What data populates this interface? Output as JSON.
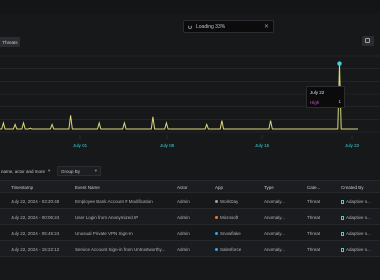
{
  "toast": {
    "text": "Loading 33%"
  },
  "tab": {
    "threats_label": "Threats"
  },
  "chart_data": {
    "type": "line",
    "x_ticks": [
      "July 01",
      "July 08",
      "July 15",
      "July 22"
    ],
    "series": [
      {
        "color": "#d9d87a",
        "values": [
          0.04,
          0.04,
          0.12,
          0.04,
          0.04,
          0.04,
          0.04,
          0.04,
          0.04,
          0.1,
          0.04,
          0.04,
          0.04,
          0.04,
          0.12,
          0.04,
          0.04,
          0.04,
          0.05,
          0.04,
          0.04,
          0.04,
          0.04,
          0.04,
          0.04,
          0.04,
          0.04,
          0.04,
          0.04,
          0.04,
          0.04,
          0.1,
          0.04,
          0.04,
          0.04,
          0.04,
          0.04,
          0.04,
          0.04,
          0.04,
          0.04,
          0.04,
          0.22,
          0.04,
          0.04,
          0.04,
          0.04,
          0.04,
          0.04,
          0.04,
          0.04,
          0.04,
          0.04,
          0.04,
          0.04,
          0.04,
          0.04,
          0.04,
          0.04,
          0.12,
          0.04,
          0.04,
          0.04,
          0.04,
          0.04,
          0.04,
          0.04,
          0.04,
          0.04,
          0.04,
          0.04,
          0.04,
          0.04,
          0.04,
          0.12,
          0.04,
          0.04,
          0.04,
          0.04,
          0.04,
          0.04,
          0.04,
          0.04,
          0.04,
          0.04,
          0.04,
          0.04,
          0.04,
          0.04,
          0.04,
          0.04,
          0.2,
          0.04,
          0.04,
          0.04,
          0.04,
          0.04,
          0.04,
          0.04,
          0.12,
          0.04,
          0.04,
          0.04,
          0.04,
          0.04,
          0.04,
          0.04,
          0.04,
          0.04,
          0.04,
          0.04,
          0.04,
          0.04,
          0.04,
          0.04,
          0.04,
          0.04,
          0.04,
          0.04,
          0.04,
          0.04,
          0.04,
          0.04,
          0.1,
          0.04,
          0.04,
          0.04,
          0.04,
          0.04,
          0.04,
          0.04,
          0.04,
          0.15,
          0.04,
          0.04,
          0.04,
          0.04,
          0.04,
          0.04,
          0.04,
          0.04,
          0.04,
          0.04,
          0.04,
          0.04,
          0.04,
          0.04,
          0.04,
          0.04,
          0.04,
          0.04,
          0.04,
          0.04,
          0.04,
          0.04,
          0.04,
          0.04,
          0.04,
          0.04,
          0.04,
          0.04,
          0.15,
          0.04,
          0.04,
          0.04,
          0.04,
          0.04,
          0.04,
          0.04,
          0.04,
          0.04,
          0.04,
          0.04,
          0.04,
          0.04,
          0.04,
          0.04,
          0.04,
          0.04,
          0.04,
          0.04,
          0.04,
          0.04,
          0.04,
          0.04,
          0.04,
          0.04,
          0.04,
          0.04,
          0.04,
          0.04,
          0.04,
          0.04,
          0.04,
          0.04,
          0.04,
          0.04,
          0.04,
          0.04,
          0.04,
          0.04,
          0.04,
          0.9,
          0.04,
          0.04,
          0.04,
          0.04,
          0.04,
          0.04,
          0.04,
          0.04,
          0.04,
          0.04,
          0.04
        ]
      }
    ],
    "highlight": {
      "color": "#3fd2d2"
    },
    "grid": true
  },
  "tooltip": {
    "date": "July 22",
    "label": "High",
    "value": "1"
  },
  "filters": {
    "search_label": "name, actor and more",
    "groupby_label": "Group By"
  },
  "table": {
    "columns": [
      "Timestamp",
      "Event Name",
      "Actor",
      "App",
      "Type",
      "Cate...",
      "Created By"
    ],
    "rows": [
      [
        "July 22, 2024 - 03:20:48",
        "Employee Bank Account # Modification",
        "Admin",
        "WorkDay",
        "Anomaly...",
        "Threat",
        "Adaptive s..."
      ],
      [
        "July 22, 2024 - 00:06:24",
        "User Login from Anonymized IP",
        "Admin",
        "Microsoft",
        "Anomaly...",
        "Threat",
        "Adaptive s..."
      ],
      [
        "July 22, 2024 - 05:45:24",
        "Unusual Private VPN Sign-In",
        "Admin",
        "Snowflake",
        "Anomaly...",
        "Threat",
        "Adaptive s..."
      ],
      [
        "July 22, 2024 - 15:22:12",
        "Service Account Sign-in from Untrustworthy...",
        "Admin",
        "Salesforce",
        "Anomaly...",
        "Threat",
        "Adaptive s..."
      ]
    ],
    "app_colors": [
      "#9aa0a6",
      "#e07b39",
      "#3aa0e0",
      "#3fa0e0"
    ]
  }
}
